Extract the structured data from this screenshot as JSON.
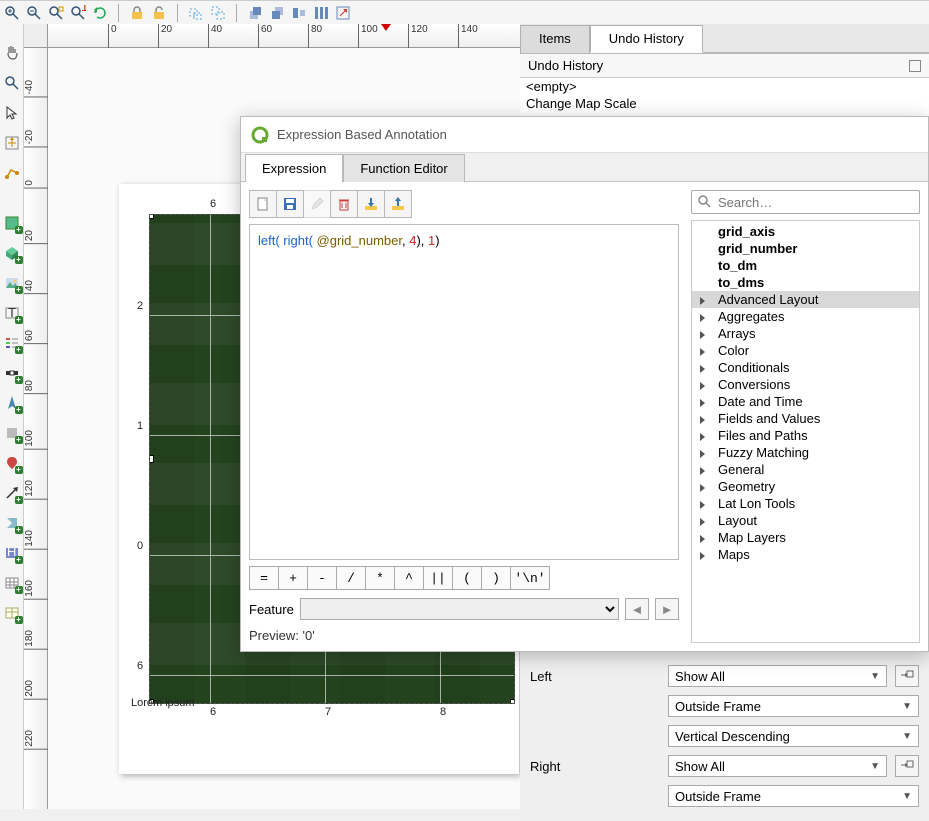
{
  "topToolbarTicks": [
    "0",
    "20",
    "40",
    "60",
    "80",
    "100",
    "120",
    "140"
  ],
  "leftRulerTicks": [
    "-40",
    "-20",
    "0",
    "20",
    "40",
    "60",
    "80",
    "100",
    "120",
    "140",
    "160",
    "180",
    "200",
    "220"
  ],
  "page": {
    "label": "Lorem ipsum",
    "topAxis": "6",
    "bottomAxis": [
      "6",
      "7",
      "8"
    ],
    "leftAxis": [
      "2",
      "1",
      "0",
      "6"
    ]
  },
  "rightPanel": {
    "tabs": [
      {
        "id": "items",
        "label": "Items",
        "active": false
      },
      {
        "id": "undo",
        "label": "Undo History",
        "active": true
      }
    ],
    "panelTitle": "Undo History",
    "undoEntries": [
      "<empty>",
      "Change Map Scale"
    ]
  },
  "gridProps": {
    "leftLabel": "Left",
    "rightLabel": "Right",
    "leftShow": "Show All",
    "leftPos": "Outside Frame",
    "leftDir": "Vertical Descending",
    "rightShow": "Show All",
    "rightPos": "Outside Frame"
  },
  "dialog": {
    "title": "Expression Based Annotation",
    "tabs": [
      {
        "id": "expr",
        "label": "Expression",
        "active": true
      },
      {
        "id": "fe",
        "label": "Function Editor",
        "active": false
      }
    ],
    "expression": {
      "fn1": "left(",
      "fn2": " right(",
      "var": " @grid_number",
      "comma1": ",",
      "num1": " 4",
      "close1": "),",
      "num2": " 1",
      "close2": ")"
    },
    "operators": [
      "=",
      "+",
      "-",
      "/",
      "*",
      "^",
      "||",
      "(",
      ")",
      "'\\n'"
    ],
    "featureLabel": "Feature",
    "navPrev": "◄",
    "navNext": "►",
    "previewLabel": "Preview:",
    "previewValue": "'0'",
    "searchPlaceholder": "Search…",
    "funcTop": [
      "grid_axis",
      "grid_number",
      "to_dm",
      "to_dms"
    ],
    "funcGroups": [
      "Advanced Layout",
      "Aggregates",
      "Arrays",
      "Color",
      "Conditionals",
      "Conversions",
      "Date and Time",
      "Fields and Values",
      "Files and Paths",
      "Fuzzy Matching",
      "General",
      "Geometry",
      "Lat Lon Tools",
      "Layout",
      "Map Layers",
      "Maps"
    ]
  }
}
